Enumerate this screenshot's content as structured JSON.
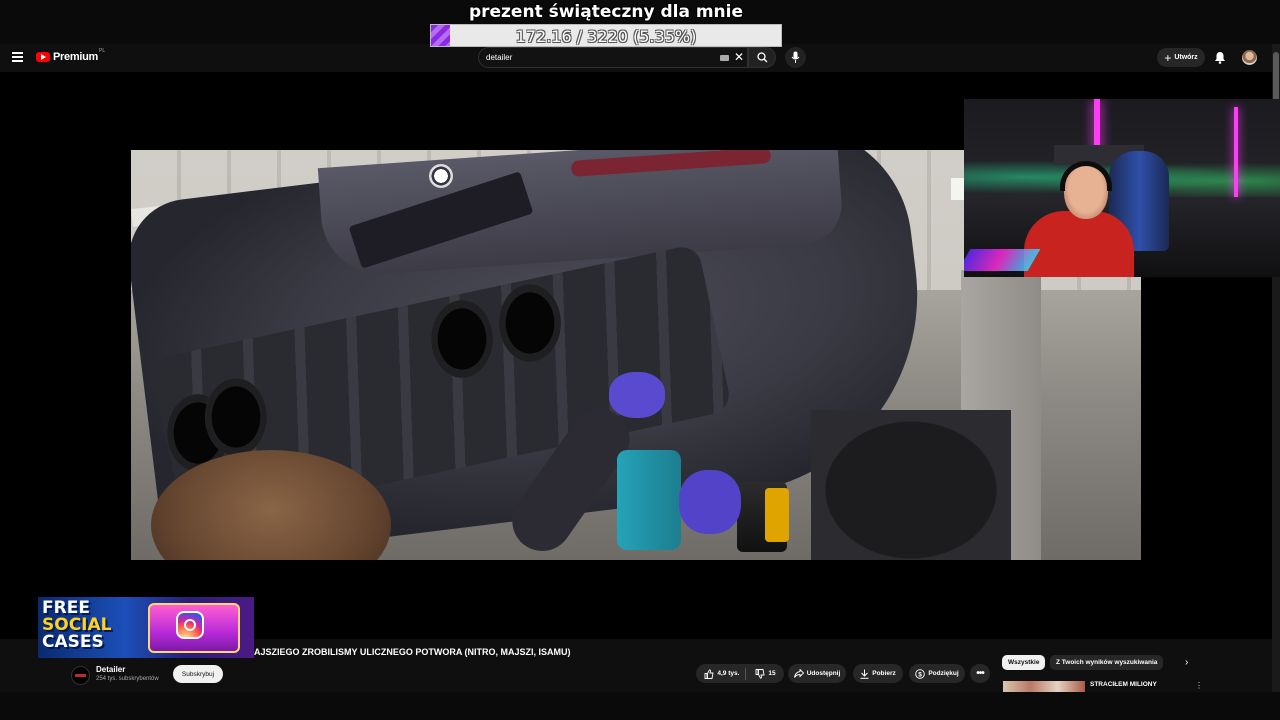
{
  "overlay": {
    "goal_title": "prezent świąteczny dla mnie",
    "goal_progress_text": "172.16 / 3220 (5.35%)",
    "goal_progress_fraction": 0.0535
  },
  "header": {
    "logo_text": "Premium",
    "logo_region": "PL",
    "search_value": "detailer",
    "create_label": "Utwórz"
  },
  "video": {
    "title": "AJSZIEGO ZROBILISMY ULICZNEGO POTWORA (NITRO, MAJSZI, ISAMU)",
    "channel_name": "Detailer",
    "subscribers": "254 tys. subskrybentów",
    "subscribe_label": "Subskrybuj",
    "likes": "4,9 tys.",
    "dislikes": "15",
    "share_label": "Udostępnij",
    "download_label": "Pobierz",
    "thanks_label": "Podziękuj",
    "more_label": "•••"
  },
  "sidebar": {
    "chips": [
      "Wszystkie",
      "Z Twoich wyników wyszukiwania"
    ],
    "recommended_title": "STRACIŁEM MILIONY"
  },
  "ad": {
    "line1": "FREE",
    "line2": "SOCIAL",
    "line3": "CASES"
  },
  "icons": {
    "menu": "menu-icon",
    "search": "search-icon",
    "mic": "mic-icon",
    "bell": "bell-icon"
  },
  "colors": {
    "brand_red": "#ff0000",
    "goal_fill": "#8a2be2",
    "background": "#0f0f0f"
  }
}
